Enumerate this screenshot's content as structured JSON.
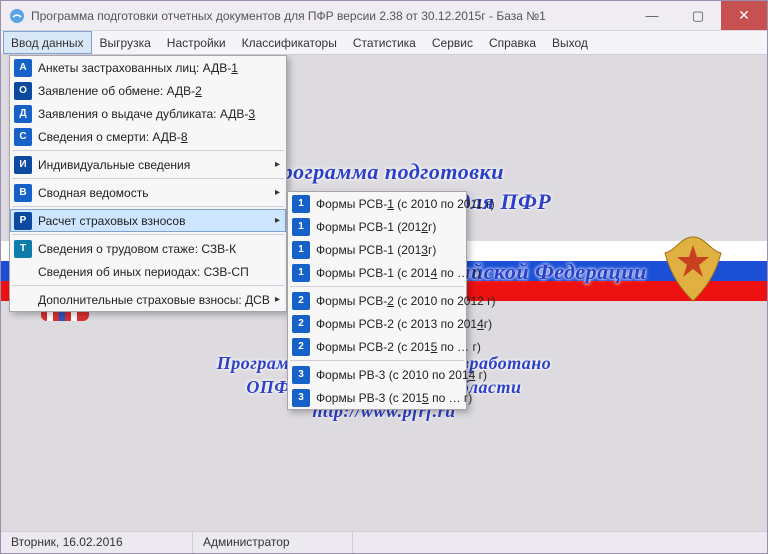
{
  "window": {
    "title": "Программа подготовки отчетных документов для ПФР версии 2.38 от 30.12.2015г - База №1"
  },
  "menubar": [
    "Ввод данных",
    "Выгрузка",
    "Настройки",
    "Классификаторы",
    "Статистика",
    "Сервис",
    "Справка",
    "Выход"
  ],
  "menu_active_index": 0,
  "dropdown_main": [
    {
      "icon": "А",
      "icls": "ic-blue",
      "label": "Анкеты застрахованных лиц: АДВ-",
      "ul": "1",
      "submenu": false
    },
    {
      "icon": "О",
      "icls": "ic-dblue",
      "label": "Заявление об обмене: АДВ-",
      "ul": "2",
      "submenu": false
    },
    {
      "icon": "Д",
      "icls": "ic-blue",
      "label": "Заявления о выдаче дубликата: АДВ-",
      "ul": "3",
      "submenu": false
    },
    {
      "icon": "С",
      "icls": "ic-blue",
      "label": "Сведения о смерти: АДВ-",
      "ul": "8",
      "submenu": false
    },
    {
      "sep": true
    },
    {
      "icon": "И",
      "icls": "ic-dblue",
      "label": "Индивидуальные сведения",
      "submenu": true
    },
    {
      "sep": true
    },
    {
      "icon": "В",
      "icls": "ic-blue",
      "label": "Сводная ведомость",
      "submenu": true
    },
    {
      "sep": true
    },
    {
      "icon": "Р",
      "icls": "ic-dblue",
      "label": "Расчет страховых взносов",
      "submenu": true,
      "highlight": true
    },
    {
      "sep": true
    },
    {
      "icon": "Т",
      "icls": "ic-teal",
      "label": "Сведения о трудовом стаже: СЗВ-К",
      "submenu": false
    },
    {
      "icon": "",
      "icls": "none",
      "label": "Сведения об иных периодах: СЗВ-СП",
      "submenu": false
    },
    {
      "sep": true
    },
    {
      "icon": "",
      "icls": "none",
      "label": "Дополнительные страховые взносы: ДСВ",
      "submenu": true
    }
  ],
  "dropdown_sub": [
    {
      "icon": "1",
      "icls": "ic-blue",
      "label": "Формы РСВ-",
      "ul": "1",
      "rest": " (с 2010 по 2011 г)"
    },
    {
      "icon": "1",
      "icls": "ic-blue",
      "label": "Формы РСВ-1 (201",
      "ul": "2",
      "rest": "г)"
    },
    {
      "icon": "1",
      "icls": "ic-blue",
      "label": "Формы РСВ-1 (201",
      "ul": "3",
      "rest": "г)"
    },
    {
      "icon": "1",
      "icls": "ic-blue",
      "label": "Формы РСВ-1 (с 201",
      "ul": "4",
      "rest": " по … г)"
    },
    {
      "sep": true
    },
    {
      "icon": "2",
      "icls": "ic-blue",
      "label": "Формы РСВ-",
      "ul": "2",
      "rest": " (с 2010 по 2012 г)"
    },
    {
      "icon": "2",
      "icls": "ic-blue",
      "label": "Формы РСВ-2 (с 2013 по 201",
      "ul": "4",
      "rest": "г)"
    },
    {
      "icon": "2",
      "icls": "ic-blue",
      "label": "Формы РСВ-2 (с 201",
      "ul": "5",
      "rest": " по … г)"
    },
    {
      "sep": true
    },
    {
      "icon": "3",
      "icls": "ic-blue",
      "label": "Формы РВ-3 (с 2010 по 201",
      "ul": "4",
      "rest": " г)"
    },
    {
      "icon": "3",
      "icls": "ic-blue",
      "label": "Формы РВ-3 (с 201",
      "ul": "5",
      "rest": " по … г)"
    }
  ],
  "bg": {
    "l1": "Программа подготовки",
    "l2": "отчетных документов для ПФР",
    "l3": "Данные Пенсионного фонда Российской Федерации",
    "l4": "Программное обеспечение разработано",
    "l5": "ОПФР по Оренбургской области",
    "l6": "http://www.pfrf.ru"
  },
  "status": {
    "date": "Вторник, 16.02.2016",
    "user": "Администратор"
  }
}
